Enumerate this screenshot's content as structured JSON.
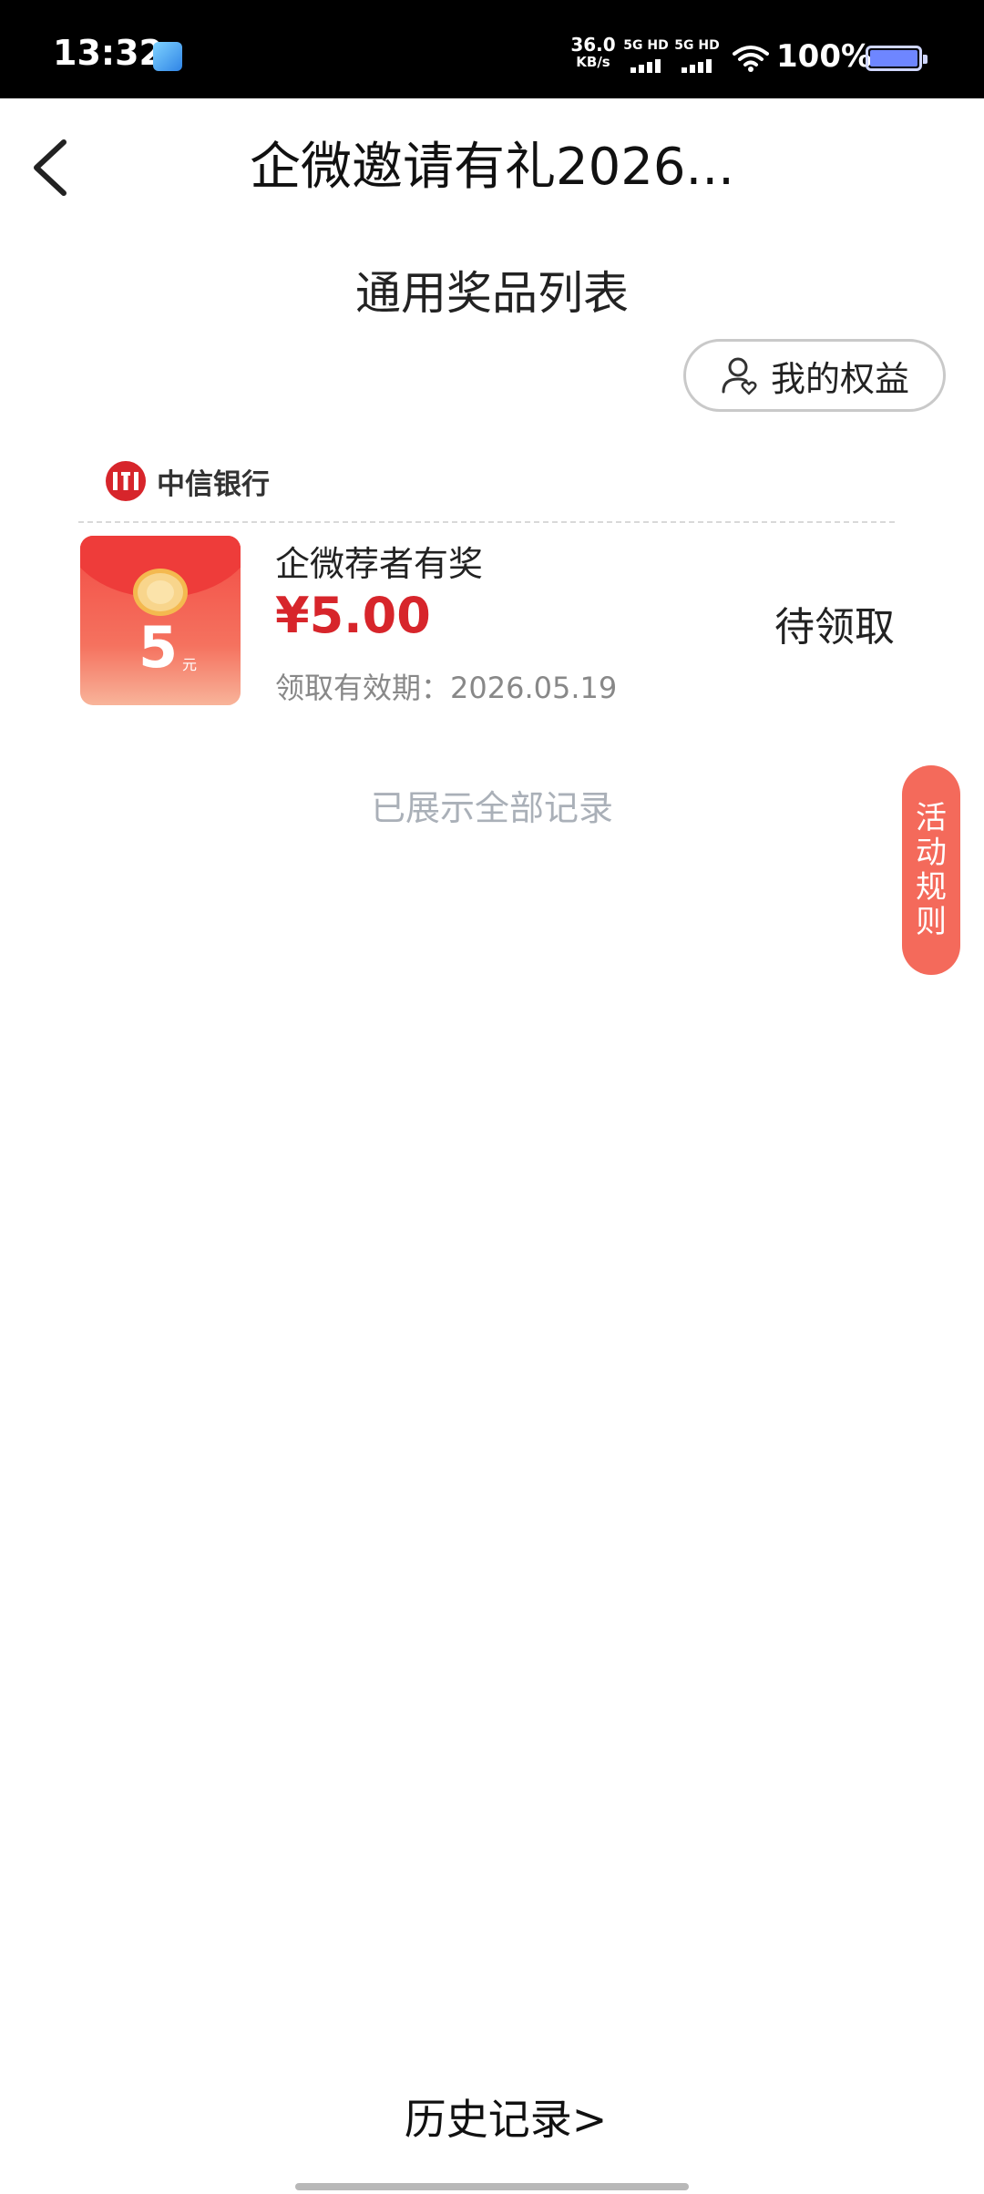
{
  "status_bar": {
    "time": "13:32",
    "net_speed_value": "36.0",
    "net_speed_unit": "KB/s",
    "sim1_label": "5G HD",
    "sim2_label": "5G HD",
    "battery_percent": "100%",
    "battery_level": 1.0
  },
  "header": {
    "title": "企微邀请有礼2026..."
  },
  "subtitle": "通用奖品列表",
  "benefit_button": {
    "label": "我的权益"
  },
  "bank": {
    "name": "中信银行",
    "logo_color": "#d7252b"
  },
  "prize": {
    "envelope_value": "5",
    "envelope_unit": "元",
    "name": "企微荐者有奖",
    "amount": "¥5.00",
    "validity": "领取有效期：2026.05.19",
    "status": "待领取"
  },
  "list_end_text": "已展示全部记录",
  "rules_tab": {
    "label": "活动规则",
    "color": "#f46a5b"
  },
  "history_link": "历史记录>",
  "colors": {
    "accent_red": "#d7252b",
    "muted_text": "#aab0b8"
  }
}
